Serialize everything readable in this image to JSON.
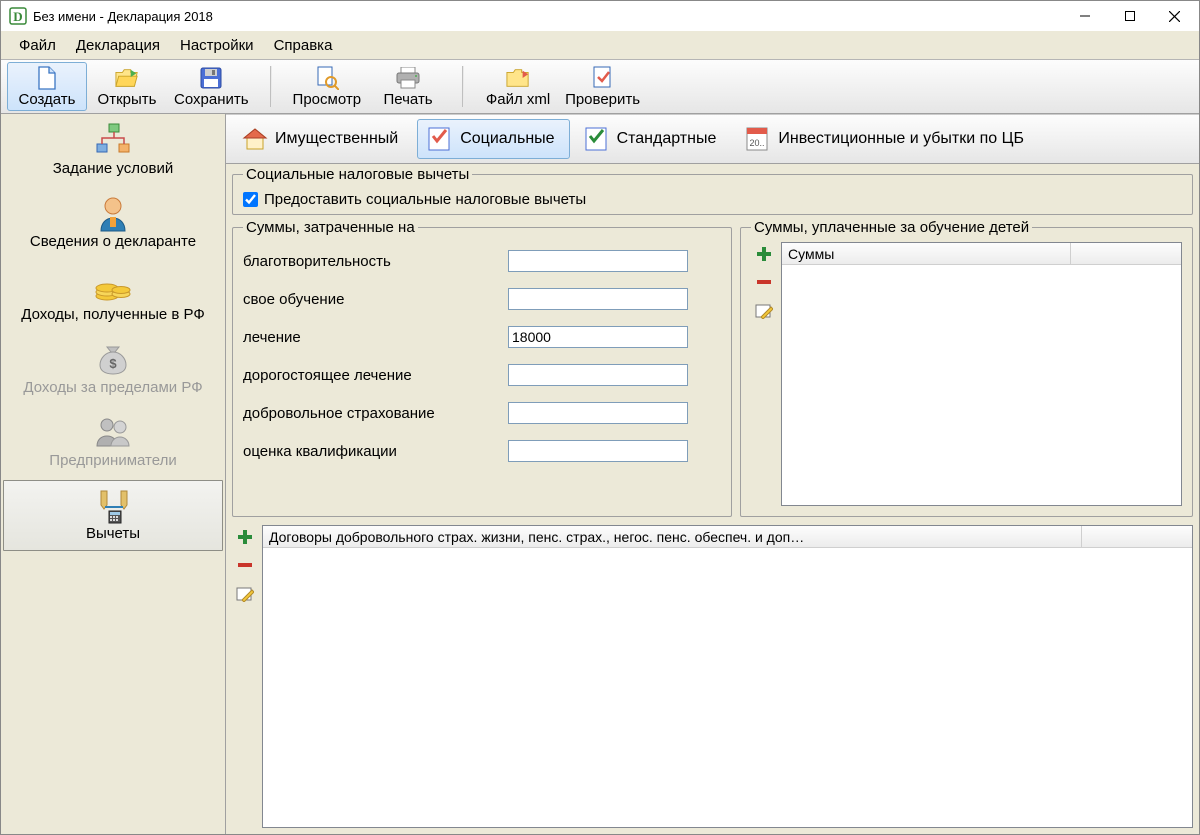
{
  "title": "Без имени - Декларация 2018",
  "menu": [
    "Файл",
    "Декларация",
    "Настройки",
    "Справка"
  ],
  "toolbar": [
    {
      "id": "create",
      "label": "Создать",
      "active": true
    },
    {
      "id": "open",
      "label": "Открыть"
    },
    {
      "id": "save",
      "label": "Сохранить"
    },
    {
      "id": "preview",
      "label": "Просмотр",
      "sep_before": true
    },
    {
      "id": "print",
      "label": "Печать"
    },
    {
      "id": "xml",
      "label": "Файл xml",
      "sep_before": true
    },
    {
      "id": "check",
      "label": "Проверить"
    }
  ],
  "sidebar": [
    {
      "id": "conditions",
      "label": "Задание условий"
    },
    {
      "id": "declarant",
      "label": "Сведения о декларанте"
    },
    {
      "id": "income_rf",
      "label": "Доходы, полученные в РФ"
    },
    {
      "id": "income_abroad",
      "label": "Доходы за пределами РФ",
      "disabled": true
    },
    {
      "id": "entrepreneurs",
      "label": "Предприниматели",
      "disabled": true
    },
    {
      "id": "deductions",
      "label": "Вычеты",
      "selected": true
    }
  ],
  "subtabs": [
    {
      "id": "property",
      "label": "Имущественный"
    },
    {
      "id": "social",
      "label": "Социальные",
      "active": true
    },
    {
      "id": "standard",
      "label": "Стандартные"
    },
    {
      "id": "investment",
      "label": "Инвестиционные и убытки по ЦБ"
    }
  ],
  "group_social_title": "Социальные налоговые вычеты",
  "provide_social_label": "Предоставить социальные налоговые вычеты",
  "provide_social_checked": true,
  "sums_spent_title": "Суммы, затраченные на",
  "spent_fields": [
    {
      "id": "charity",
      "label": "благотворительность",
      "value": ""
    },
    {
      "id": "own_education",
      "label": "свое обучение",
      "value": ""
    },
    {
      "id": "treatment",
      "label": "лечение",
      "value": "18000"
    },
    {
      "id": "expensive_treatment",
      "label": "дорогостоящее лечение",
      "value": ""
    },
    {
      "id": "voluntary_insurance",
      "label": "добровольное страхование",
      "value": ""
    },
    {
      "id": "qualification",
      "label": "оценка квалификации",
      "value": ""
    }
  ],
  "children_education_title": "Суммы, уплаченные за обучение детей",
  "children_header": "Суммы",
  "contracts_header": "Договоры добровольного страх. жизни, пенс. страх., негос. пенс. обеспеч. и доп…"
}
